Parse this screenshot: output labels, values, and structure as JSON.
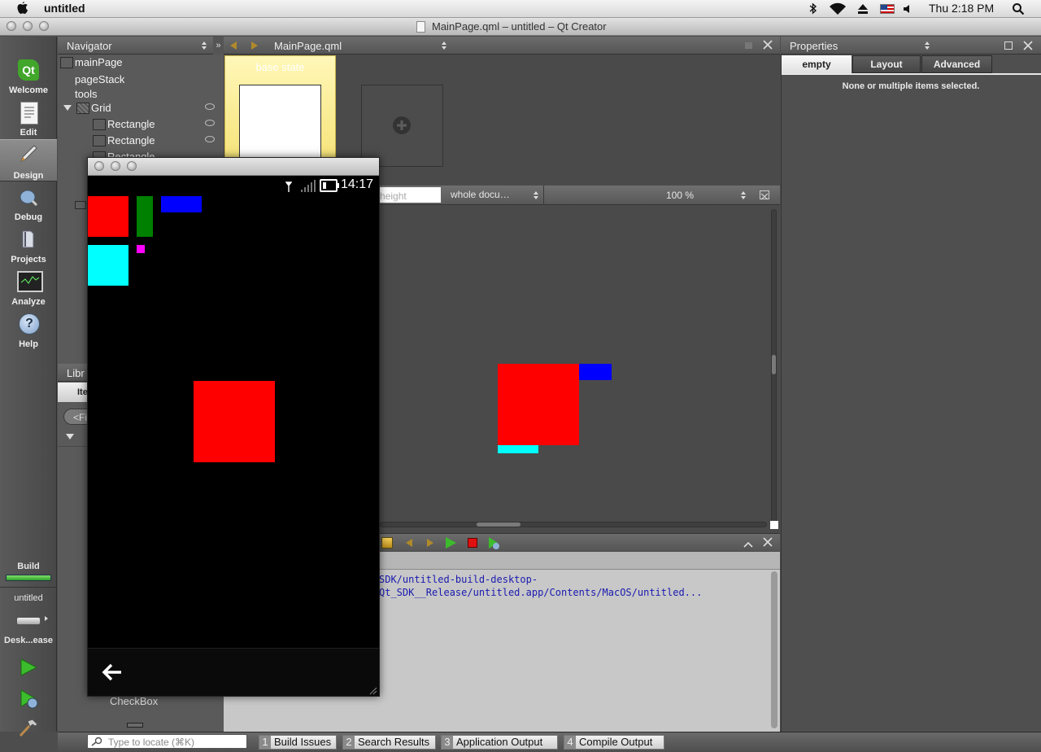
{
  "menubar": {
    "app": "untitled",
    "clock": "Thu 2:18 PM"
  },
  "window": {
    "title": "MainPage.qml – untitled – Qt Creator"
  },
  "modes": [
    {
      "label": "Welcome",
      "icon": "qt-logo-icon"
    },
    {
      "label": "Edit",
      "icon": "edit-document-icon"
    },
    {
      "label": "Design",
      "icon": "design-brush-icon"
    },
    {
      "label": "Debug",
      "icon": "debug-bug-icon"
    },
    {
      "label": "Projects",
      "icon": "projects-icon"
    },
    {
      "label": "Analyze",
      "icon": "analyze-monitor-icon"
    },
    {
      "label": "Help",
      "icon": "help-icon"
    }
  ],
  "build": {
    "label": "Build",
    "project": "untitled",
    "kit": "Desk...ease"
  },
  "navigator": {
    "title": "Navigator",
    "items": [
      "mainPage",
      "pageStack",
      "tools",
      "Grid",
      "Rectangle",
      "Rectangle",
      "Rectangle"
    ]
  },
  "library": {
    "title": "Libr",
    "tab": "Ite",
    "filter": "<Fi",
    "item": "CheckBox"
  },
  "editor": {
    "file": "MainPage.qml",
    "state": "base state",
    "height_field": "height",
    "scope": "whole docu…",
    "zoom": "100 %"
  },
  "properties": {
    "title": "Properties",
    "tabs": [
      "empty",
      "Layout",
      "Advanced"
    ],
    "message": "None or multiple items selected."
  },
  "output": {
    "line1": "SDK/untitled-build-desktop-",
    "line2": "Qt_SDK__Release/untitled.app/Contents/MacOS/untitled..."
  },
  "phone": {
    "clock": "14:17"
  },
  "locator": {
    "placeholder": "Type to locate (⌘K)"
  },
  "output_tabs": [
    {
      "num": "1",
      "label": "Build Issues"
    },
    {
      "num": "2",
      "label": "Search Results"
    },
    {
      "num": "3",
      "label": "Application Output"
    },
    {
      "num": "4",
      "label": "Compile Output"
    }
  ],
  "colors": {
    "red": "#ff0000",
    "green": "#008000",
    "blue": "#0000ff",
    "cyan": "#00ffff",
    "magenta": "#ff00ff"
  }
}
